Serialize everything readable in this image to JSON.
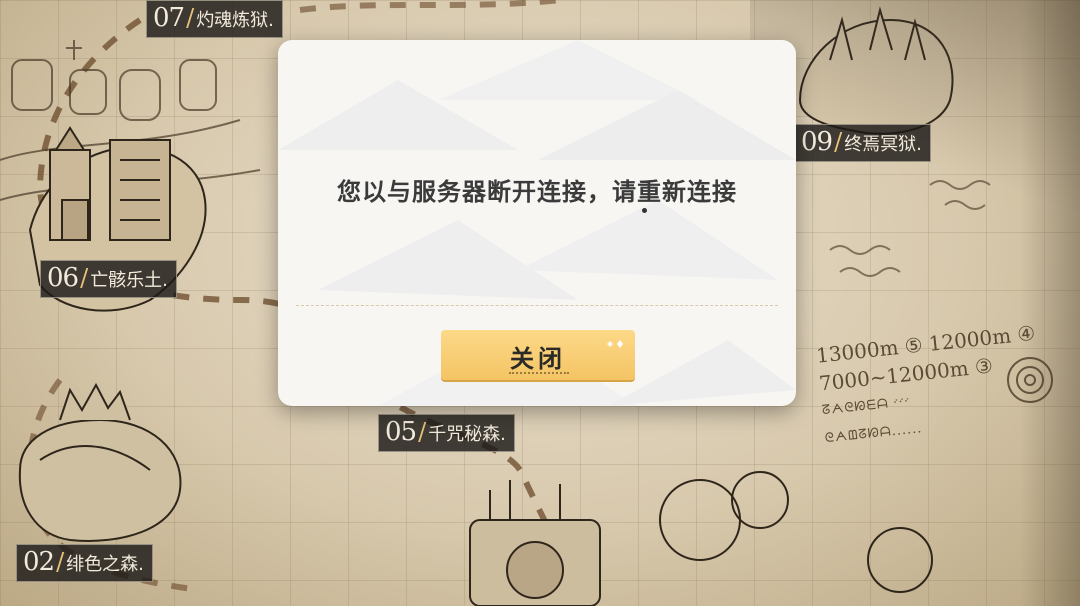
{
  "dialog": {
    "message": "您以与服务器断开连接，请重新连接",
    "close_label": "关闭"
  },
  "locations": [
    {
      "id": "07",
      "name": "灼魂炼狱."
    },
    {
      "id": "09",
      "name": "终焉冥狱."
    },
    {
      "id": "06",
      "name": "亡骸乐土."
    },
    {
      "id": "05",
      "name": "千咒秘森."
    },
    {
      "id": "02",
      "name": "绯色之森."
    }
  ],
  "map_notes": {
    "line1": "13000m ⑤  12000m ④",
    "line2": "7000~12000m ③",
    "line3": "ᘔᗅᘓᘗᗴᗩ ᐝᐝᐝ",
    "line4": "ᘓᗅᗶᘔᘗᗩ......"
  },
  "colors": {
    "button_fill": "#f4c464",
    "label_bg": "#1c1a18",
    "map_paper": "#e2d6bf",
    "slash_accent": "#e7c278"
  }
}
